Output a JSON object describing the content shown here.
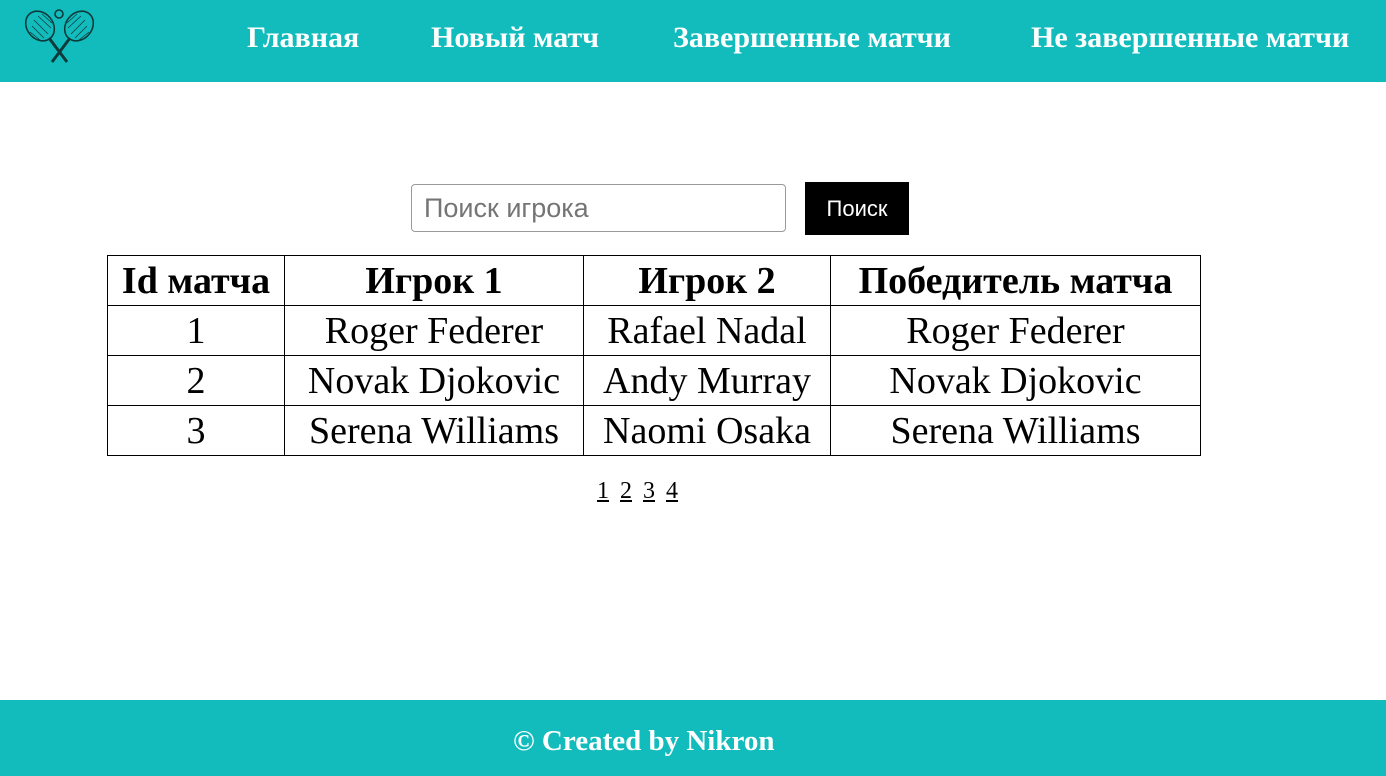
{
  "header": {
    "logo_icon": "tennis-rackets-icon",
    "nav": [
      {
        "label": "Главная"
      },
      {
        "label": "Новый матч"
      },
      {
        "label": "Завершенные матчи"
      },
      {
        "label": "Не завершенные матчи"
      }
    ]
  },
  "search": {
    "placeholder": "Поиск игрока",
    "value": "",
    "button_label": "Поиск"
  },
  "table": {
    "headers": [
      "Id матча",
      "Игрок 1",
      "Игрок 2",
      "Победитель матча"
    ],
    "rows": [
      [
        "1",
        "Roger Federer",
        "Rafael Nadal",
        "Roger Federer"
      ],
      [
        "2",
        "Novak Djokovic",
        "Andy Murray",
        "Novak Djokovic"
      ],
      [
        "3",
        "Serena Williams",
        "Naomi Osaka",
        "Serena Williams"
      ]
    ]
  },
  "pagination": {
    "pages": [
      "1",
      "2",
      "3",
      "4"
    ]
  },
  "footer": {
    "text": "© Created by Nikron"
  },
  "colors": {
    "brand": "#12bcbd",
    "button": "#000000"
  }
}
